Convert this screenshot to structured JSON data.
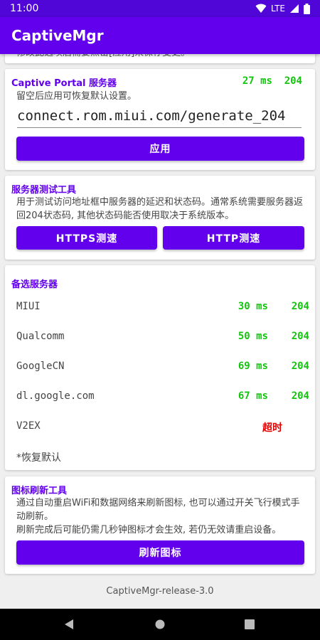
{
  "status": {
    "time": "11:00",
    "network": "LTE"
  },
  "appbar": {
    "title": "CaptiveMgr"
  },
  "partial_text": "修改此选项后需要点击[应用]来保存变更。",
  "portal": {
    "title": "Captive Portal 服务器",
    "latency": "27 ms",
    "code": "204",
    "hint": "留空后应用可恢复默认设置。",
    "input_value": "connect.rom.miui.com/generate_204",
    "apply_label": "应用"
  },
  "test_tool": {
    "title": "服务器测试工具",
    "desc": "用于测试访问地址框中服务器的延迟和状态码。通常系统需要服务器返回204状态码, 其他状态码能否使用取决于系统版本。",
    "https_label": "HTTPS测速",
    "http_label": "HTTP测速"
  },
  "alt_servers": {
    "title": "备选服务器",
    "items": [
      {
        "name": "MIUI",
        "latency": "30 ms",
        "code": "204"
      },
      {
        "name": "Qualcomm",
        "latency": "50 ms",
        "code": "204"
      },
      {
        "name": "GoogleCN",
        "latency": "69 ms",
        "code": "204"
      },
      {
        "name": "dl.google.com",
        "latency": "67 ms",
        "code": "204"
      },
      {
        "name": "V2EX",
        "status": "超时"
      }
    ],
    "restore_label": "*恢复默认"
  },
  "icon_refresh": {
    "title": "图标刷新工具",
    "desc1": "通过自动重启WiFi和数据网络来刷新图标, 也可以通过开关飞行模式手动刷新。",
    "desc2": "刷新完成后可能仍需几秒钟图标才会生效, 若仍无效请重启设备。",
    "button_label": "刷新图标"
  },
  "footer": {
    "version": "CaptiveMgr-release-3.0"
  },
  "colors": {
    "primary": "#6200ee",
    "status_ok": "#15c410",
    "status_error": "#e00000"
  },
  "icons": [
    "wifi-icon",
    "signal-icon",
    "battery-icon",
    "back-icon",
    "home-icon",
    "recents-icon"
  ]
}
